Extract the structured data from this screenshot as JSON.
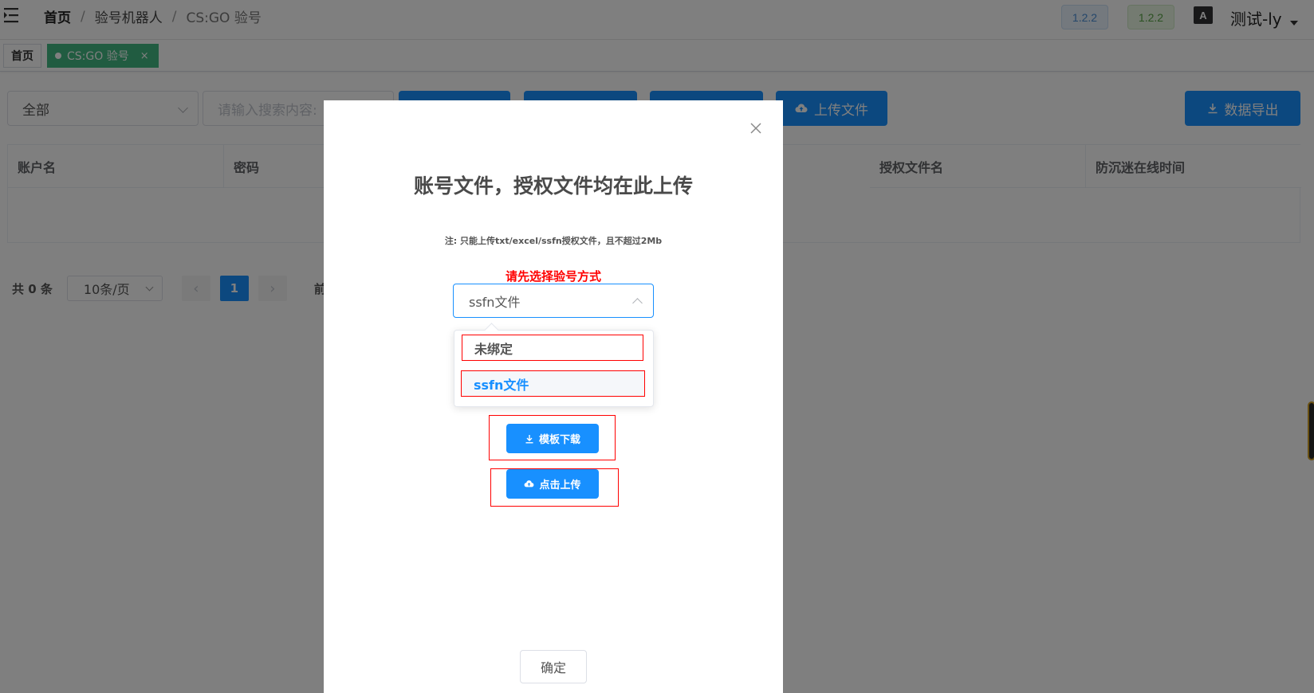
{
  "header": {
    "breadcrumb": [
      "首页",
      "验号机器人",
      "CS:GO 验号"
    ],
    "version_badges": [
      "1.2.2",
      "1.2.2"
    ],
    "translate_icon": "A",
    "username": "测试-ly"
  },
  "tags": {
    "home": "首页",
    "active": "CS:GO 验号",
    "active_close": "×"
  },
  "toolbar": {
    "filter_value": "全部",
    "search_placeholder": "请输入搜索内容:",
    "upload_label": "上传文件",
    "export_label": "数据导出"
  },
  "table": {
    "headers": [
      "账户名",
      "密码",
      "授权文件名",
      "防沉迷在线时间"
    ]
  },
  "pagination": {
    "total": "共 0 条",
    "page_size": "10条/页",
    "prev": "‹",
    "current_page": "1",
    "next": "›",
    "goto": "前"
  },
  "dialog": {
    "close_glyph": "×",
    "title": "账号文件，授权文件均在此上传",
    "note": "注:  只能上传txt/excel/ssfn授权文件，且不超过2Mb",
    "warning": "请先选择验号方式",
    "selected_method": "ssfn文件",
    "options": [
      "未绑定",
      "ssfn文件"
    ],
    "template_download": "模板下载",
    "click_upload": "点击上传",
    "confirm": "确定"
  },
  "colors": {
    "primary": "#1890ff",
    "tag_active": "#42b983",
    "warning": "#ff0000",
    "overlay": "rgba(0,0,0,0.5)"
  }
}
